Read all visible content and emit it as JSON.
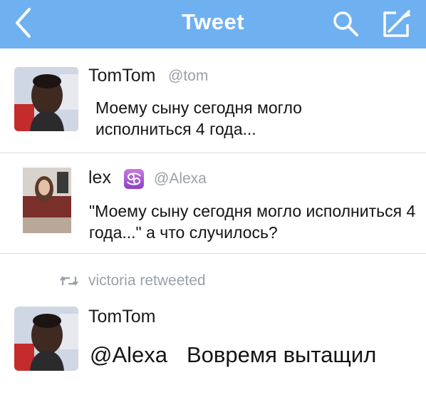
{
  "header": {
    "title": "Tweet",
    "back_icon": "chevron-left-icon",
    "search_icon": "search-icon",
    "compose_icon": "compose-icon",
    "background": "#6fb1f0"
  },
  "tweet1": {
    "name": "TomTom",
    "handle": "@tom",
    "text": "Моему сыну сегодня могло исполниться 4 года..."
  },
  "tweet2": {
    "name": "lex",
    "badge_icon": "cancer-zodiac-emoji",
    "handle": "@Alexa",
    "text": "\"Моему сыну сегодня могло исполниться 4 года...\" а что случилось?"
  },
  "retweet": {
    "icon": "retweet-icon",
    "label": "victoria retweeted"
  },
  "tweet3": {
    "name": "TomTom",
    "mention": "@Alexa",
    "text": "Вовремя вытащил"
  }
}
